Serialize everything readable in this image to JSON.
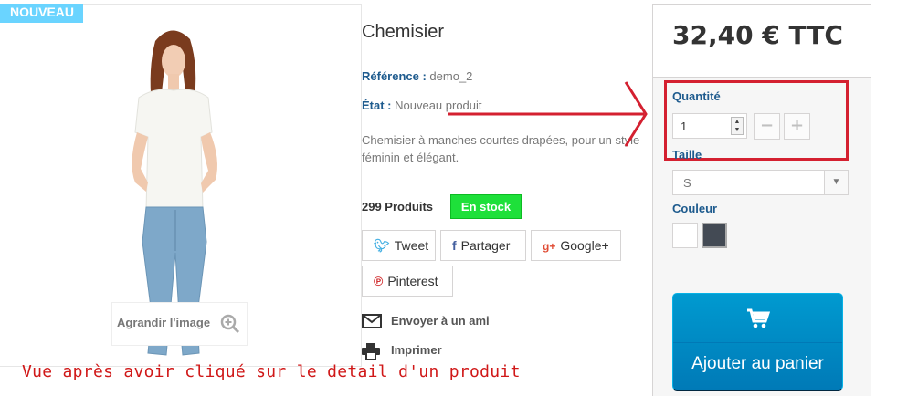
{
  "product": {
    "badge": "NOUVEAU",
    "title": "Chemisier",
    "reference_label": "Référence :",
    "reference_value": " demo_2",
    "condition_label": "État :",
    "condition_value": " Nouveau produit",
    "description": "Chemisier à manches courtes drapées, pour un style féminin et élégant.",
    "quantity_text": "299 Produits",
    "stock_badge": "En stock",
    "zoom_label": "Agrandir l'image"
  },
  "share": {
    "tweet": "Tweet",
    "facebook": "Partager",
    "google": "Google+",
    "pinterest": "Pinterest",
    "tweet_icon": "twitter-icon",
    "facebook_icon": "facebook-icon",
    "google_icon": "google-plus-icon",
    "pinterest_icon": "pinterest-icon"
  },
  "extras": {
    "send_friend": "Envoyer à un ami",
    "print": "Imprimer"
  },
  "buy": {
    "price": "32,40 € TTC",
    "quantity_label": "Quantité",
    "quantity_value": "1",
    "size_label": "Taille",
    "size_selected": "S",
    "color_label": "Couleur",
    "colors": [
      "#ffffff",
      "#434a54"
    ],
    "add_to_cart": "Ajouter au panier"
  },
  "caption": "Vue après avoir cliqué sur le detail d'un produit",
  "colors": {
    "accent_blue": "#1e5b8e",
    "stock_green": "#1ee03a",
    "cart_blue": "#0087c5",
    "annotation_red": "#d42030"
  }
}
